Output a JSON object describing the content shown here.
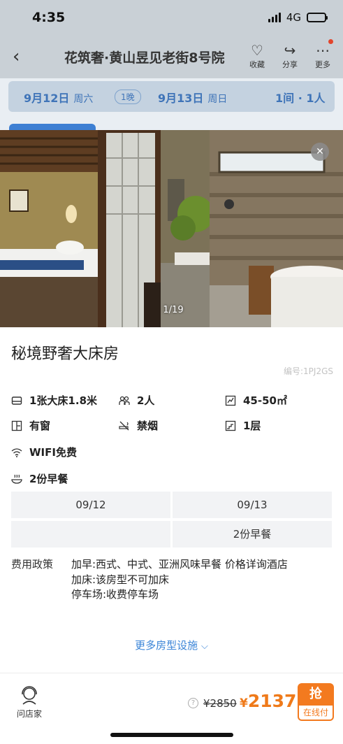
{
  "status": {
    "time": "4:35",
    "network": "4G"
  },
  "nav": {
    "title": "花筑奢·黄山昱见老街8号院",
    "favorite_label": "收藏",
    "share_label": "分享",
    "more_label": "更多"
  },
  "dates": {
    "checkin_date": "9月12日",
    "checkin_day": "周六",
    "nights": "1晚",
    "checkout_date": "9月13日",
    "checkout_day": "周日",
    "rooms_guests": "1间 · 1人"
  },
  "gallery": {
    "counter": "1/19"
  },
  "room": {
    "name": "秘境野奢大床房",
    "code": "编号:1PJ2GS",
    "facilities": {
      "bed": "1张大床1.8米",
      "guests": "2人",
      "area": "45-50㎡",
      "window": "有窗",
      "smoking": "禁烟",
      "floor": "1层",
      "wifi": "WIFI免费",
      "breakfast": "2份早餐"
    }
  },
  "meal_table": {
    "headers": [
      "09/12",
      "09/13"
    ],
    "values": [
      "",
      "2份早餐"
    ]
  },
  "policy": {
    "label": "费用政策",
    "lines": [
      "加早:西式、中式、亚洲风味早餐 价格详询酒店",
      "加床:该房型不可加床",
      "停车场:收费停车场"
    ]
  },
  "more_link": "更多房型设施",
  "footer": {
    "ask_label": "问店家",
    "help_icon": "?",
    "original_price": "¥2850",
    "currency": "¥",
    "price": "2137",
    "book_label": "抢",
    "pay_label": "在线付"
  },
  "colors": {
    "accent": "#3a84d7",
    "price": "#ef7a1a",
    "book": "#f37a1f"
  }
}
